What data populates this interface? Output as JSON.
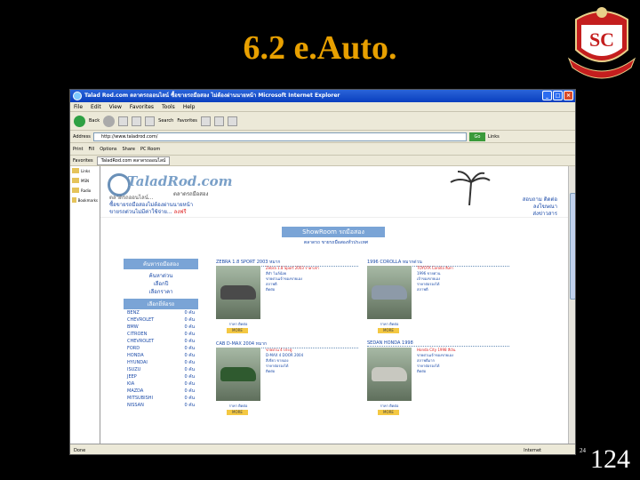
{
  "slide": {
    "title": "6.2 e.Auto.",
    "page_number": "124",
    "page_number_small": "24"
  },
  "browser": {
    "window_title": "Talad Rod.com ตลาดรถออนไลน์ ซื้อขายรถมือสอง ไม่ต้องผ่านนายหน้า Microsoft Internet Explorer",
    "menu": [
      "File",
      "Edit",
      "View",
      "Favorites",
      "Tools",
      "Help"
    ],
    "toolbar": {
      "back": "Back",
      "search": "Search",
      "favorites": "Favorites"
    },
    "address_label": "Address",
    "address_value": "http://www.taladrod.com/",
    "go_label": "Go",
    "links_label": "Links",
    "favorites_label": "Favorites",
    "links": [
      "Print",
      "Fill",
      "Options",
      "Share",
      "PC Room"
    ],
    "tab_label": "TaladRod.com ตลาดรถออนไลน์",
    "status_text": "Done",
    "status_zone": "Internet",
    "favorites_items": [
      "Links",
      "MSN",
      "Radio",
      "Bookmarks"
    ]
  },
  "site": {
    "logo": "TaladRod.com",
    "subtitle": "ตลาดรถมือสอง",
    "welcome_lines": [
      "ตลาดรถออนไลน์...",
      "ซื้อขายรถมือสองไม่ต้องผ่านนายหน้า",
      "ขายรถด่วนไม่มีค่าใช้จ่าย..."
    ],
    "welcome_hot": "ลงฟรี",
    "contact_lines": [
      "สอบถาม ติดต่อ",
      "ลงโฆษณา",
      "ส่งข่าวสาร"
    ],
    "showroom_button": "ShowRoom รถมือสอง",
    "showroom_sub": "ตลาดรถ ขายรถมือสองทั่วประเทศ",
    "menu_search_head": "ค้นหารถมือสอง",
    "menu_search_links": [
      "ค้นหาด่วน",
      "เลือกปี",
      "เลือกราคา"
    ],
    "menu_brand_head": "เลือกยี่ห้อรถ",
    "brands": [
      {
        "name": "BENZ",
        "count": "0 คัน"
      },
      {
        "name": "CHEVROLET",
        "count": "0 คัน"
      },
      {
        "name": "BMW",
        "count": "0 คัน"
      },
      {
        "name": "CITROEN",
        "count": "0 คัน"
      },
      {
        "name": "CHEVROLET",
        "count": "0 คัน"
      },
      {
        "name": "FORD",
        "count": "0 คัน"
      },
      {
        "name": "HONDA",
        "count": "0 คัน"
      },
      {
        "name": "HYUNDAI",
        "count": "0 คัน"
      },
      {
        "name": "ISUZU",
        "count": "0 คัน"
      },
      {
        "name": "JEEP",
        "count": "0 คัน"
      },
      {
        "name": "KIA",
        "count": "0 คัน"
      },
      {
        "name": "MAZDA",
        "count": "0 คัน"
      },
      {
        "name": "MITSUBISHI",
        "count": "0 คัน"
      },
      {
        "name": "NISSAN",
        "count": "0 คัน"
      }
    ],
    "listings": [
      {
        "head": "ZEBRA 1.8 SPORT 2003 หมาก",
        "lines": [
          "Zebra 1.8 Sport 2003 ราคาเช่า",
          "สีดำ ไมล์น้อย",
          "ขายด่วนเจ้าของขายเอง",
          "สภาพดี",
          "ติดต่อ"
        ],
        "price": "ราคา ติดต่อ",
        "more": "MORE",
        "car_color": "#4a4a4a"
      },
      {
        "head": "1996 COROLLA หมากด่วน",
        "lines": [
          "TOYOTA Corolla สีเทา",
          "1996 ขายด่วน",
          "เจ้าของขายเอง",
          "ราคาต่อรองได้",
          "สภาพดี"
        ],
        "price": "ราคา ติดต่อ",
        "more": "MORE",
        "car_color": "#8d9aa8"
      },
      {
        "head": "CAB D-MAX 2004 หมาก",
        "lines": [
          "ขายด่วน 4 ประตู",
          "D-MAX 4 DOOR 2004",
          "สีเขียว ขายเอง",
          "ราคาต่อรองได้",
          "ติดต่อ"
        ],
        "price": "ราคา ติดต่อ",
        "more": "MORE",
        "car_color": "#2f5a2f"
      },
      {
        "head": "SEDAN HONDA 1998",
        "lines": [
          "Honda City 1998 สีเงิน",
          "ขายด่วนเจ้าของขายเอง",
          "สภาพดีมาก",
          "ราคาต่อรองได้",
          "ติดต่อ"
        ],
        "price": "ราคา ติดต่อ",
        "more": "MORE",
        "car_color": "#c8c8c0"
      }
    ]
  }
}
